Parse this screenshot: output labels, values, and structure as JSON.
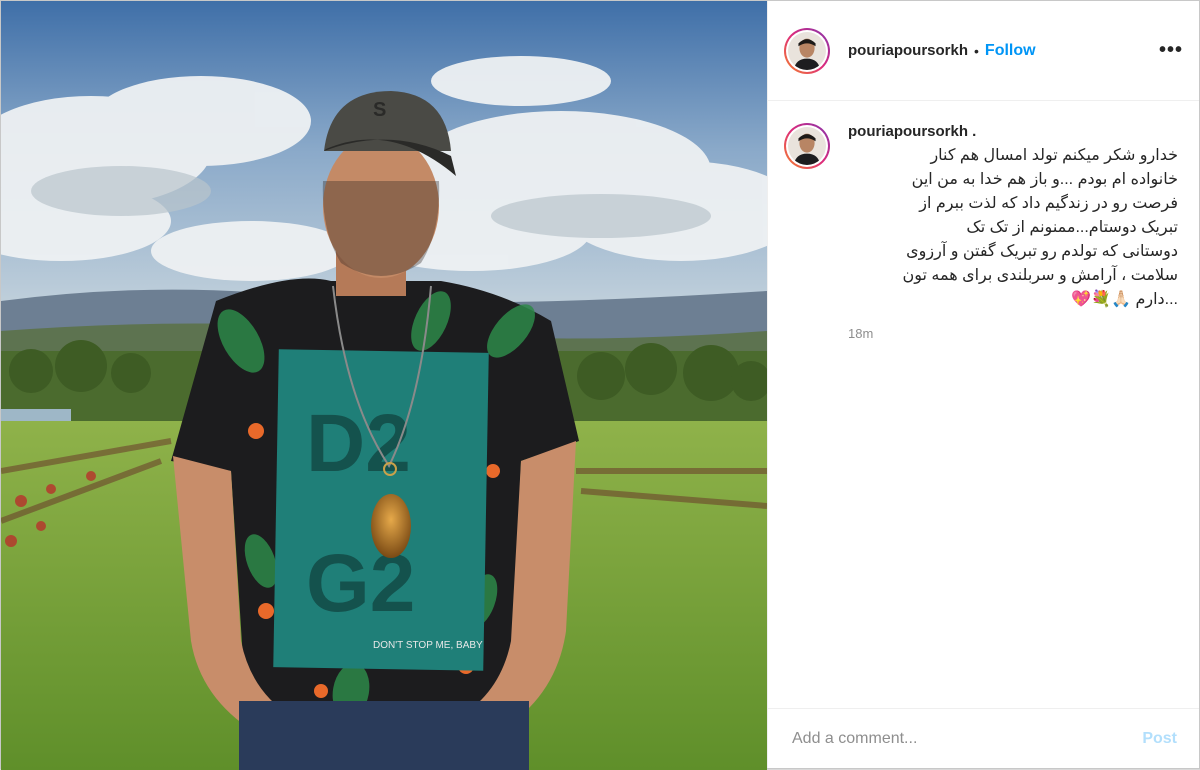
{
  "header": {
    "username": "pouriapoursorkh",
    "separator": "•",
    "follow_label": "Follow",
    "more_label": "•••"
  },
  "caption": {
    "username": "pouriapoursorkh .",
    "text": "خدارو شکر میکنم تولد امسال هم کنار\nخانواده ام بودم ...و باز هم خدا به من این\nفرصت رو در زندگیم داد که لذت ببرم از\nتبریک دوستام...ممنونم از تک تک\nدوستانی که تولدم رو تبریک گفتن و آرزوی\nسلامت ، آرامش و سربلندی برای همه تون\n...دارم 🙏🏻💐💖",
    "time": "18m"
  },
  "comment_box": {
    "placeholder": "Add a comment...",
    "post_label": "Post"
  },
  "photo": {
    "cap_logo": "S",
    "shirt_print_line1": "D2",
    "shirt_print_line2": "G2",
    "shirt_slogan": "DON'T STOP ME, BABY",
    "colors": {
      "shirt_panel": "#1f7f78",
      "sky": "#4f7fb5",
      "grass": "#7aa43d"
    }
  },
  "colors": {
    "accent": "#0095f6",
    "post_disabled": "#b2dffc",
    "muted": "#8e8e8e",
    "text": "#262626"
  }
}
